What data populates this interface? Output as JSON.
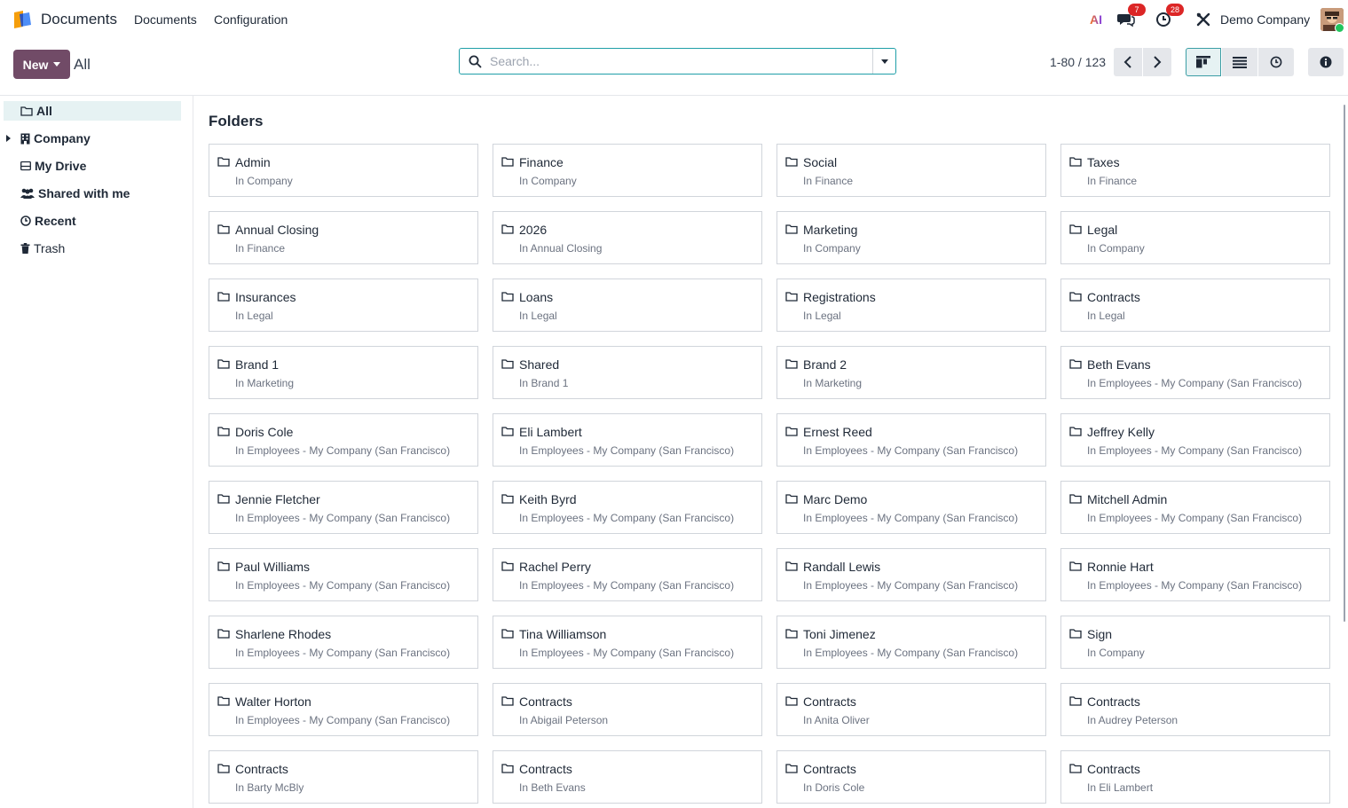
{
  "navbar": {
    "app_name": "Documents",
    "menu": [
      "Documents",
      "Configuration"
    ],
    "ai_label": "AI",
    "messages_count": "7",
    "activities_count": "28",
    "company": "Demo Company"
  },
  "control": {
    "new_label": "New",
    "breadcrumb": "All",
    "search_placeholder": "Search...",
    "pager": "1-80 / 123"
  },
  "sidebar": {
    "items": [
      {
        "label": "All",
        "icon": "folder-icon"
      },
      {
        "label": "Company",
        "icon": "building-icon"
      },
      {
        "label": "My Drive",
        "icon": "drive-icon"
      },
      {
        "label": "Shared with me",
        "icon": "users-icon"
      },
      {
        "label": "Recent",
        "icon": "clock-icon"
      },
      {
        "label": "Trash",
        "icon": "trash-icon"
      }
    ]
  },
  "main": {
    "section_title": "Folders",
    "folders": [
      {
        "name": "Admin",
        "location": "In Company"
      },
      {
        "name": "Finance",
        "location": "In Company"
      },
      {
        "name": "Social",
        "location": "In Finance"
      },
      {
        "name": "Taxes",
        "location": "In Finance"
      },
      {
        "name": "Annual Closing",
        "location": "In Finance"
      },
      {
        "name": "2026",
        "location": "In Annual Closing"
      },
      {
        "name": "Marketing",
        "location": "In Company"
      },
      {
        "name": "Legal",
        "location": "In Company"
      },
      {
        "name": "Insurances",
        "location": "In Legal"
      },
      {
        "name": "Loans",
        "location": "In Legal"
      },
      {
        "name": "Registrations",
        "location": "In Legal"
      },
      {
        "name": "Contracts",
        "location": "In Legal"
      },
      {
        "name": "Brand 1",
        "location": "In Marketing"
      },
      {
        "name": "Shared",
        "location": "In Brand 1"
      },
      {
        "name": "Brand 2",
        "location": "In Marketing"
      },
      {
        "name": "Beth Evans",
        "location": "In Employees - My Company (San Francisco)"
      },
      {
        "name": "Doris Cole",
        "location": "In Employees - My Company (San Francisco)"
      },
      {
        "name": "Eli Lambert",
        "location": "In Employees - My Company (San Francisco)"
      },
      {
        "name": "Ernest Reed",
        "location": "In Employees - My Company (San Francisco)"
      },
      {
        "name": "Jeffrey Kelly",
        "location": "In Employees - My Company (San Francisco)"
      },
      {
        "name": "Jennie Fletcher",
        "location": "In Employees - My Company (San Francisco)"
      },
      {
        "name": "Keith Byrd",
        "location": "In Employees - My Company (San Francisco)"
      },
      {
        "name": "Marc Demo",
        "location": "In Employees - My Company (San Francisco)"
      },
      {
        "name": "Mitchell Admin",
        "location": "In Employees - My Company (San Francisco)"
      },
      {
        "name": "Paul Williams",
        "location": "In Employees - My Company (San Francisco)"
      },
      {
        "name": "Rachel Perry",
        "location": "In Employees - My Company (San Francisco)"
      },
      {
        "name": "Randall Lewis",
        "location": "In Employees - My Company (San Francisco)"
      },
      {
        "name": "Ronnie Hart",
        "location": "In Employees - My Company (San Francisco)"
      },
      {
        "name": "Sharlene Rhodes",
        "location": "In Employees - My Company (San Francisco)"
      },
      {
        "name": "Tina Williamson",
        "location": "In Employees - My Company (San Francisco)"
      },
      {
        "name": "Toni Jimenez",
        "location": "In Employees - My Company (San Francisco)"
      },
      {
        "name": "Sign",
        "location": "In Company"
      },
      {
        "name": "Walter Horton",
        "location": "In Employees - My Company (San Francisco)"
      },
      {
        "name": "Contracts",
        "location": "In Abigail Peterson"
      },
      {
        "name": "Contracts",
        "location": "In Anita Oliver"
      },
      {
        "name": "Contracts",
        "location": "In Audrey Peterson"
      },
      {
        "name": "Contracts",
        "location": "In Barty McBly"
      },
      {
        "name": "Contracts",
        "location": "In Beth Evans"
      },
      {
        "name": "Contracts",
        "location": "In Doris Cole"
      },
      {
        "name": "Contracts",
        "location": "In Eli Lambert"
      }
    ]
  },
  "colors": {
    "brand": "#714b67",
    "accent": "#1f9fa8",
    "badge": "#dc2626"
  }
}
